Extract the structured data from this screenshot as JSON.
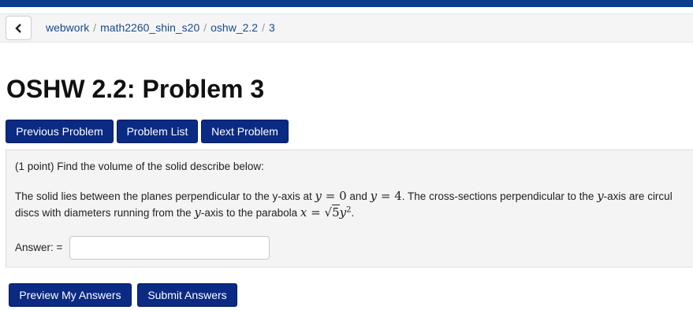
{
  "header": {
    "bar_color": "#0b3d8c"
  },
  "breadcrumb": {
    "back_icon": "chevron-left-icon",
    "items": [
      "webwork",
      "math2260_shin_s20",
      "oshw_2.2",
      "3"
    ],
    "separator": "/"
  },
  "page_title": "OSHW 2.2: Problem 3",
  "nav": {
    "previous_label": "Previous Problem",
    "list_label": "Problem List",
    "next_label": "Next Problem"
  },
  "problem": {
    "intro": "(1 point) Find the volume of the solid describe below:",
    "line1": {
      "t1": "The solid lies between the planes perpendicular to the y-axis at ",
      "m1": "y",
      "m1op": " = ",
      "m1val": "0",
      "t2": " and ",
      "m2": "y",
      "m2op": " = ",
      "m2val": "4",
      "t3": ". The cross-sections perpendicular to the ",
      "m3": "y",
      "t4": "-axis are circul"
    },
    "line2": {
      "t1": "discs with diameters running from the ",
      "m1": "y",
      "t2": "-axis to the parabola ",
      "m2": "x",
      "m2op": " = ",
      "radicand": "5",
      "m3": "y",
      "exp": "2",
      "t3": "."
    },
    "answer_label": "Answer: =",
    "answer_value": ""
  },
  "actions": {
    "preview_label": "Preview My Answers",
    "submit_label": "Submit Answers"
  },
  "colors": {
    "button_bg": "#0a2a83",
    "link": "#1a4a8a",
    "panel_bg": "#f4f4f4"
  }
}
